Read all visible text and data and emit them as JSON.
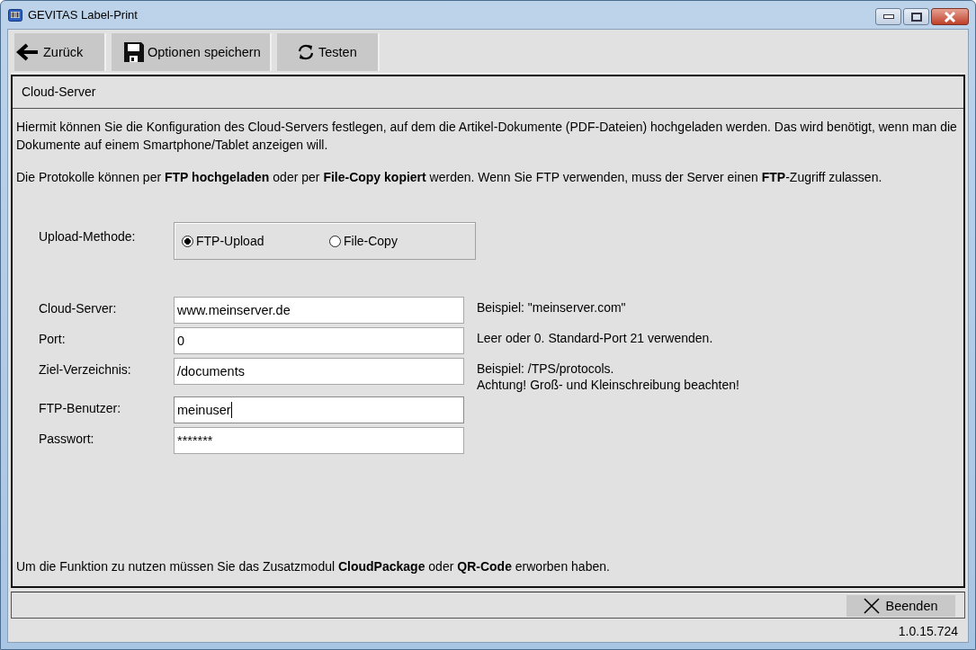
{
  "window": {
    "title": "GEVITAS Label-Print"
  },
  "toolbar": [
    {
      "label": "Zurück",
      "kind": "back"
    },
    {
      "label": "Optionen speichern",
      "kind": "save"
    },
    {
      "label": "Testen",
      "kind": "refresh"
    }
  ],
  "panel": {
    "title": "Cloud-Server",
    "paragraphs": [
      "Hiermit können Sie die Konfiguration des Cloud-Servers festlegen, auf dem die Artikel-Dokumente (PDF-Dateien) hochgeladen werden. Das wird benötigt, wenn man die Dokumente auf einem Smartphone/Tablet anzeigen will.",
      "Die Protokolle können per **FTP hochgeladen** oder per **File-Copy kopiert** werden. Wenn Sie FTP verwenden, muss der Server einen **FTP**-Zugriff zulassen."
    ],
    "upload_method": {
      "label": "Upload-Methode:",
      "options": [
        {
          "label": "FTP-Upload",
          "selected": true
        },
        {
          "label": "File-Copy",
          "selected": false
        }
      ]
    },
    "fields": [
      {
        "label": "Cloud-Server:",
        "value": "www.meinserver.de",
        "focused": false,
        "hint": [
          "Beispiel: \"meinserver.com\""
        ]
      },
      {
        "label": "Port:",
        "value": "0",
        "focused": false,
        "hint": [
          "Leer oder 0. Standard-Port 21 verwenden."
        ]
      },
      {
        "label": "Ziel-Verzeichnis:",
        "value": "/documents",
        "focused": false,
        "hint": [
          "Beispiel: /TPS/protocols.",
          "Achtung! Groß- und Kleinschreibung beachten!"
        ]
      },
      {
        "label": "FTP-Benutzer:",
        "value": "meinuser",
        "focused": true
      },
      {
        "label": "Passwort:",
        "value": "*******",
        "focused": false
      }
    ],
    "note": "Um die Funktion zu nutzen müssen Sie das Zusatzmodul **CloudPackage** oder **QR-Code** erworben haben."
  },
  "footer": {
    "button": "Beenden",
    "version": "1.0.15.724"
  }
}
